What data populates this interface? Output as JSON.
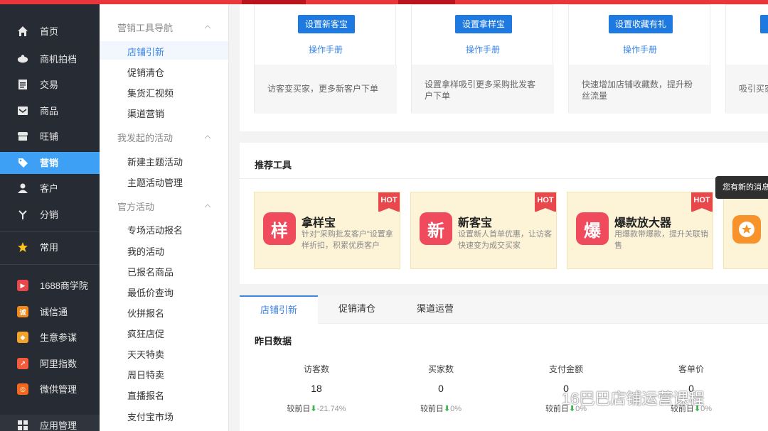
{
  "nav": {
    "items": [
      {
        "label": "首页",
        "icon": "home-icon"
      },
      {
        "label": "商机拍档",
        "icon": "handshake-icon"
      },
      {
        "label": "交易",
        "icon": "clipboard-icon"
      },
      {
        "label": "商品",
        "icon": "inbox-icon"
      },
      {
        "label": "旺铺",
        "icon": "shop-icon"
      },
      {
        "label": "营销",
        "icon": "tag-icon"
      },
      {
        "label": "客户",
        "icon": "user-icon"
      },
      {
        "label": "分销",
        "icon": "split-icon"
      },
      {
        "label": "常用",
        "icon": "star-icon"
      },
      {
        "label": "1688商学院",
        "icon": "academy-icon"
      },
      {
        "label": "诚信通",
        "icon": "chengxintong-icon"
      },
      {
        "label": "生意参谋",
        "icon": "compass-icon"
      },
      {
        "label": "阿里指数",
        "icon": "trend-icon"
      },
      {
        "label": "微供管理",
        "icon": "weigong-icon"
      },
      {
        "label": "应用管理",
        "icon": "grid-icon"
      }
    ],
    "active_index": 5,
    "accent": "#3da0f5"
  },
  "submenu": {
    "groups": [
      {
        "title": "营销工具导航",
        "links": [
          "店铺引新",
          "促销清仓",
          "集货汇视频",
          "渠道营销"
        ]
      },
      {
        "title": "我发起的活动",
        "links": [
          "新建主题活动",
          "主题活动管理"
        ]
      },
      {
        "title": "官方活动",
        "links": [
          "专场活动报名",
          "我的活动",
          "已报名商品",
          "最低价查询",
          "伙拼报名",
          "疯狂店促",
          "天天特卖",
          "周日特卖",
          "直播报名",
          "支付宝市场"
        ]
      }
    ],
    "selected": "店铺引新"
  },
  "tools": [
    {
      "button": "设置新客宝",
      "manual": "操作手册",
      "desc": "访客变买家，更多新客户下单"
    },
    {
      "button": "设置拿样宝",
      "manual": "操作手册",
      "desc": "设置拿样吸引更多采购批发客户下单"
    },
    {
      "button": "设置收藏有礼",
      "manual": "操作手册",
      "desc": "快速增加店铺收藏数，提升粉丝流量"
    },
    {
      "button": "",
      "manual": "",
      "desc": "吸引买家"
    }
  ],
  "recommend": {
    "title": "推荐工具",
    "cards": [
      {
        "glyph": "样",
        "name": "拿样宝",
        "desc": "针对\"采购批发客户\"设置拿样折扣，积累优质客户",
        "badge": "HOT",
        "color": "#f04a5d"
      },
      {
        "glyph": "新",
        "name": "新客宝",
        "desc": "设置新人首单优惠，让访客快速变为成交买家",
        "badge": "HOT",
        "color": "#f04a5d"
      },
      {
        "glyph": "爆",
        "name": "爆款放大器",
        "desc": "用爆款带爆款，提升关联销售",
        "badge": "HOT",
        "color": "#f04a5d"
      }
    ]
  },
  "tooltip": "您有新的消息",
  "tabs": [
    "店铺引新",
    "促销清仓",
    "渠道运营"
  ],
  "active_tab": 0,
  "stats": {
    "title": "昨日数据",
    "items": [
      {
        "label": "访客数",
        "value": "18",
        "compare": "较前日",
        "change": "-21.74%"
      },
      {
        "label": "买家数",
        "value": "0",
        "compare": "较前日",
        "change": "0%"
      },
      {
        "label": "支付金额",
        "value": "0",
        "compare": "较前日",
        "change": "0%"
      },
      {
        "label": "客单价",
        "value": "0",
        "compare": "较前日",
        "change": "0%"
      }
    ]
  },
  "watermark": "16巴巴店铺运营课程"
}
